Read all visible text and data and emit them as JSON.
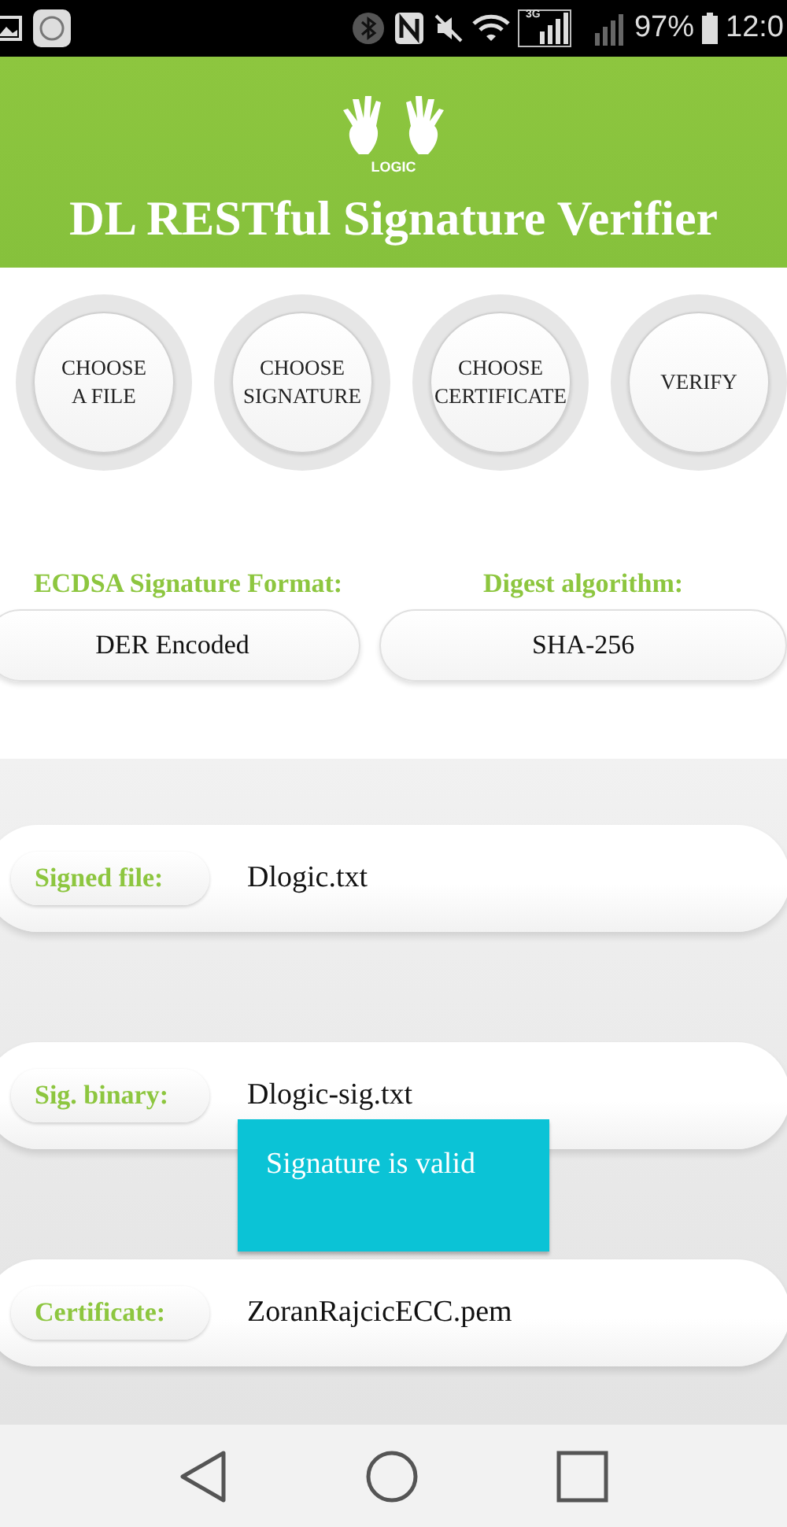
{
  "status_bar": {
    "network_label": "3G",
    "battery_percent": "97%",
    "time": "12:0"
  },
  "header": {
    "logo_text": "LOGIC",
    "title": "DL RESTful Signature Verifier"
  },
  "actions": [
    {
      "label": "CHOOSE\nA FILE"
    },
    {
      "label": "CHOOSE\nSIGNATURE"
    },
    {
      "label": "CHOOSE\nCERTIFICATE"
    },
    {
      "label": "VERIFY"
    }
  ],
  "options": [
    {
      "label": "ECDSA Signature Format:",
      "value": "DER Encoded"
    },
    {
      "label": "Digest algorithm:",
      "value": "SHA-256"
    }
  ],
  "fields": [
    {
      "label": "Signed file:",
      "value": "Dlogic.txt"
    },
    {
      "label": "Sig. binary:",
      "value": "Dlogic-sig.txt"
    },
    {
      "label": "Certificate:",
      "value": "ZoranRajcicECC.pem"
    }
  ],
  "toast": {
    "message": "Signature is valid"
  }
}
